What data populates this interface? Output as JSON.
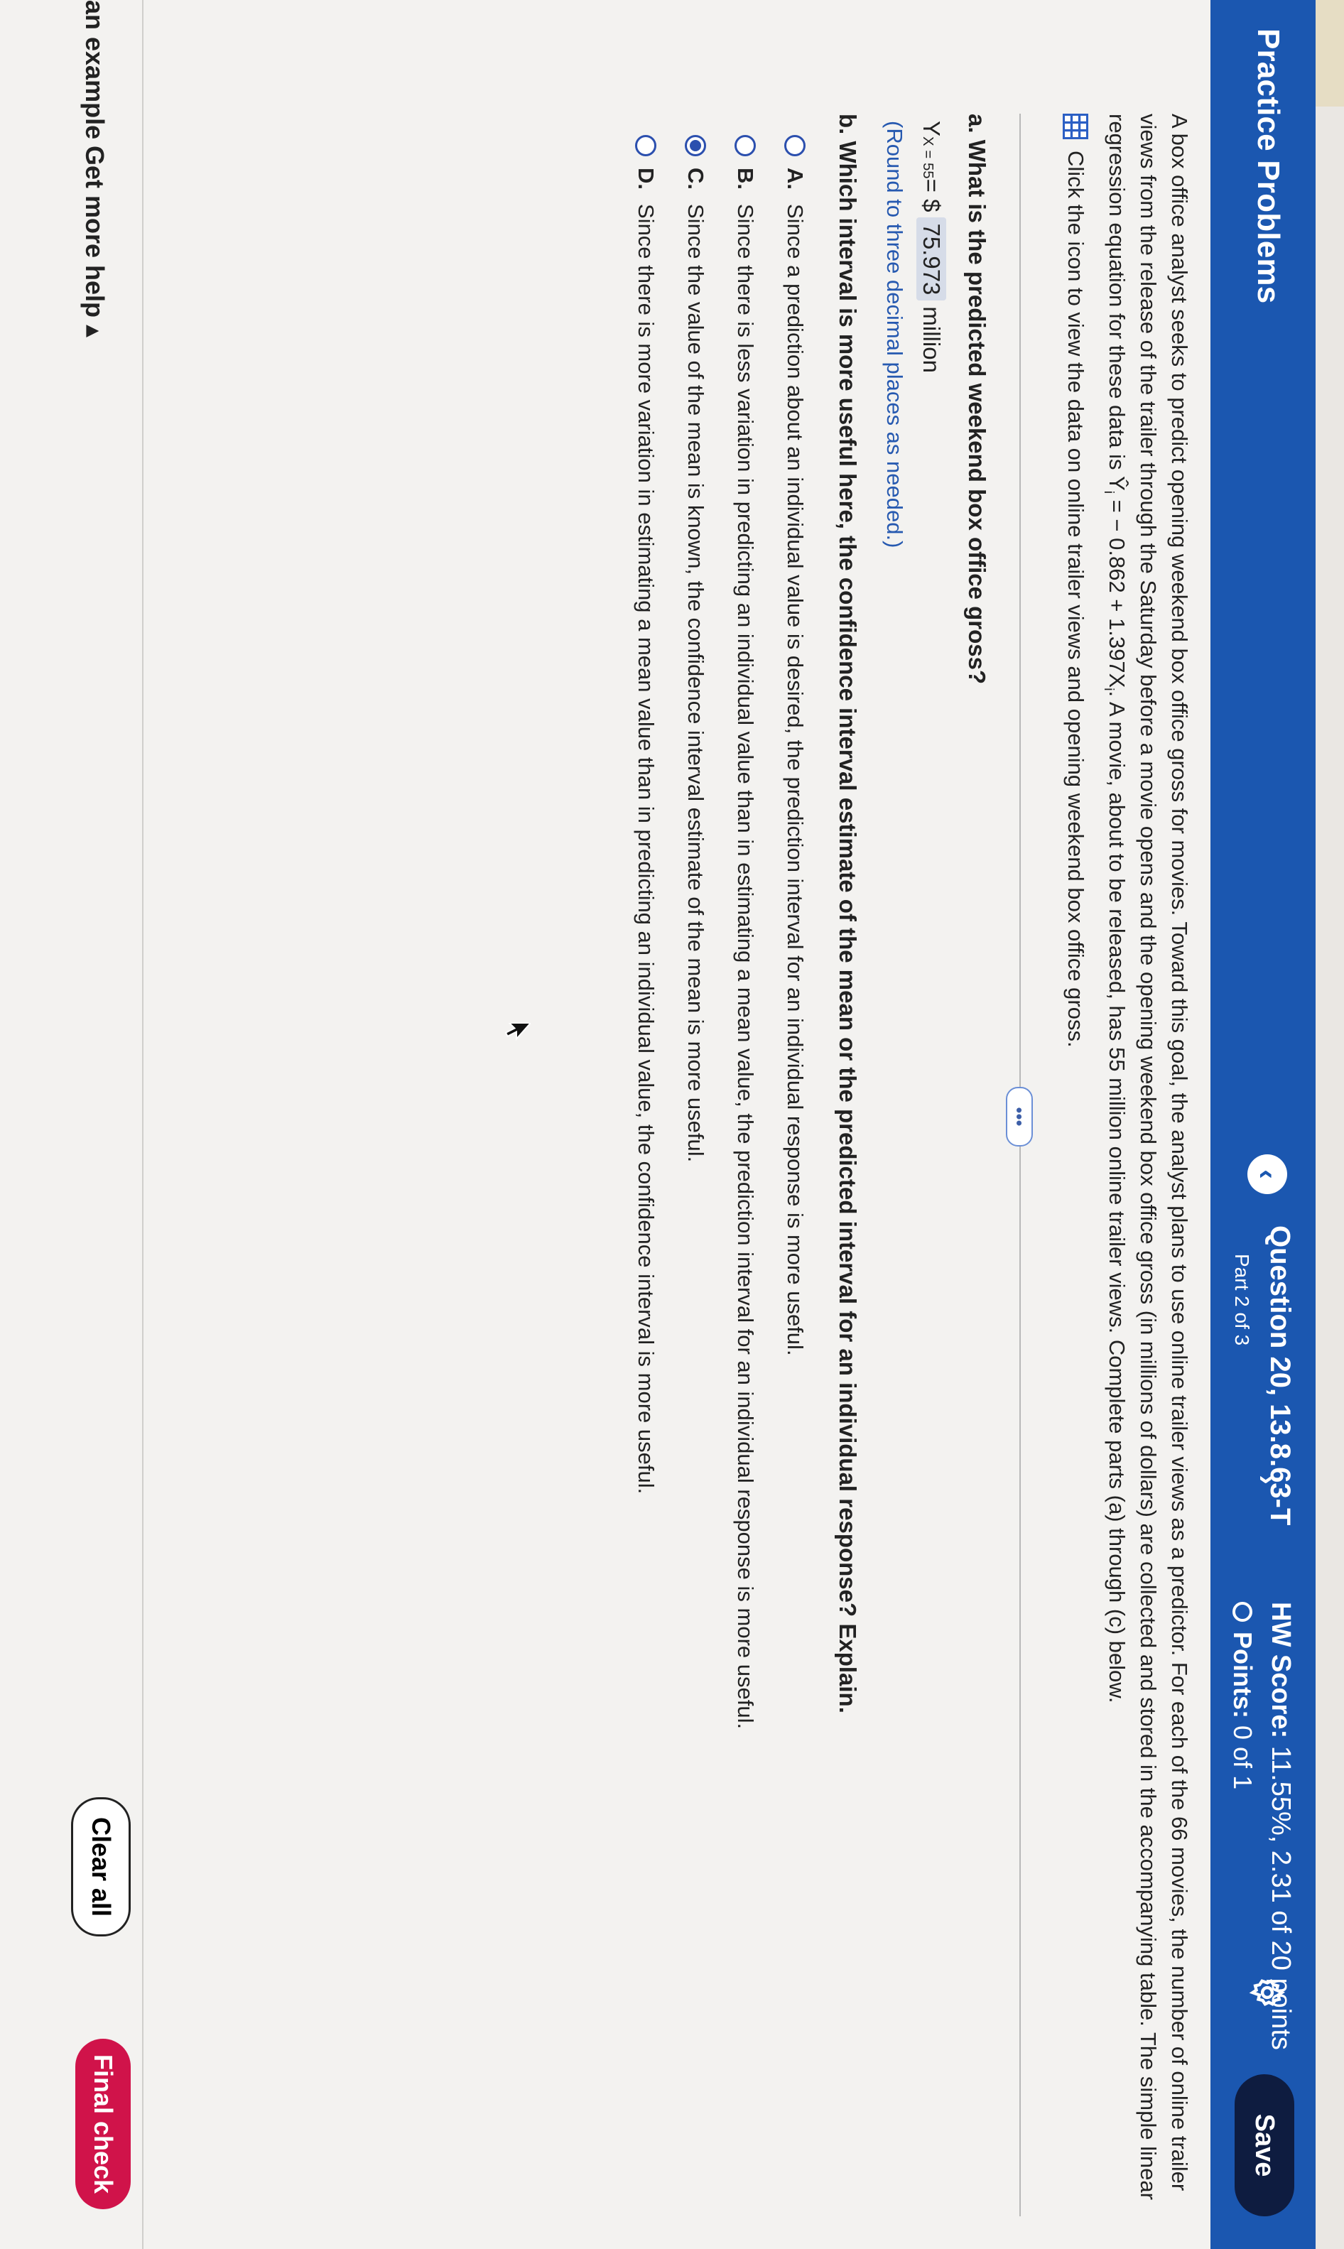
{
  "header": {
    "app_title": "Practice Problems",
    "prev_label": "‹",
    "next_label": "›",
    "question_title": "Question 20, 13.8.63-T",
    "question_part": "Part 2 of 3",
    "hw_score_label": "HW Score:",
    "hw_score_value": "11.55%, 2.31 of 20 points",
    "points_label": "Points:",
    "points_value": "0 of 1",
    "save_label": "Save"
  },
  "question": {
    "intro_line1": "A box office analyst seeks to predict opening weekend box office gross for movies. Toward this goal, the analyst plans to use online trailer views as a predictor. For each of the 66 movies, the number of online trailer",
    "intro_line2": "views from the release of the trailer through the Saturday before a movie opens and the opening weekend box office gross (in millions of dollars) are collected and stored in the accompanying table. The simple linear",
    "intro_line3_start": "regression equation for these data is ",
    "equation": "Ŷ",
    "equation_sub": "i",
    "equation_mid": " = − 0.862 + 1.397X",
    "equation_sub2": "i",
    "intro_line3_end": ". A movie, about to be released, has 55 million online trailer views. Complete parts (a) through (c) below.",
    "data_note": "Click the icon to view the data on online trailer views and opening weekend box office gross.",
    "more_label": "•••"
  },
  "part_a": {
    "question": "a. What is the predicted weekend box office gross?",
    "answer_prefix": "Y",
    "answer_sub": "X = 55",
    "answer_equals": " = $",
    "answer_value": "75.973",
    "answer_unit": "million",
    "round_note": "(Round to three decimal places as needed.)"
  },
  "part_b": {
    "question": "b. Which interval is more useful here, the confidence interval estimate of the mean or the predicted interval for an individual response? Explain.",
    "options": [
      {
        "letter": "A.",
        "text": "Since a prediction about an individual value is desired, the prediction interval for an individual response is more useful."
      },
      {
        "letter": "B.",
        "text": "Since there is less variation in predicting an individual value than in estimating a mean value, the prediction interval for an individual response is more useful."
      },
      {
        "letter": "C.",
        "text": "Since the value of the mean is known, the confidence interval estimate of the mean is more useful."
      },
      {
        "letter": "D.",
        "text": "Since there is more variation in estimating a mean value than in predicting an individual value, the confidence interval is more useful."
      }
    ]
  },
  "footer": {
    "example_label": "an example",
    "help_label": "Get more help ▴",
    "clear_label": "Clear all",
    "final_label": "Final check"
  },
  "colors": {
    "header_bg": "#1b57b0",
    "save_bg": "#0e1c40",
    "final_bg": "#d0134a",
    "radio": "#2b4fae"
  }
}
